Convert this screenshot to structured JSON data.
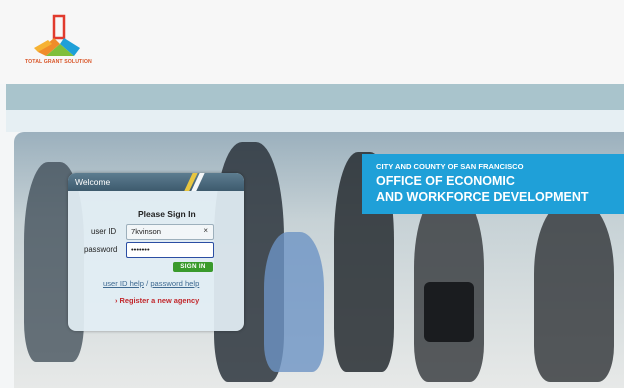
{
  "brand": {
    "logo_text": "TOTAL GRANT SOLUTION",
    "colors": {
      "red": "#e13a2d",
      "orange": "#f08c2a",
      "blue": "#1fa0d8",
      "green": "#7fbf3b"
    }
  },
  "banner": {
    "line1": "CITY AND COUNTY OF SAN FRANCISCO",
    "line2": "OFFICE OF ECONOMIC",
    "line3": "AND WORKFORCE DEVELOPMENT"
  },
  "login": {
    "header": "Welcome",
    "title": "Please Sign In",
    "user_label": "user ID",
    "user_value": "7kvinson",
    "clear_glyph": "×",
    "password_label": "password",
    "password_value": "•••••••",
    "signin_label": "SIGN IN",
    "userid_help": "user ID help",
    "separator": "/",
    "password_help": "password help",
    "register_bullet": "›",
    "register": "Register a new agency"
  }
}
